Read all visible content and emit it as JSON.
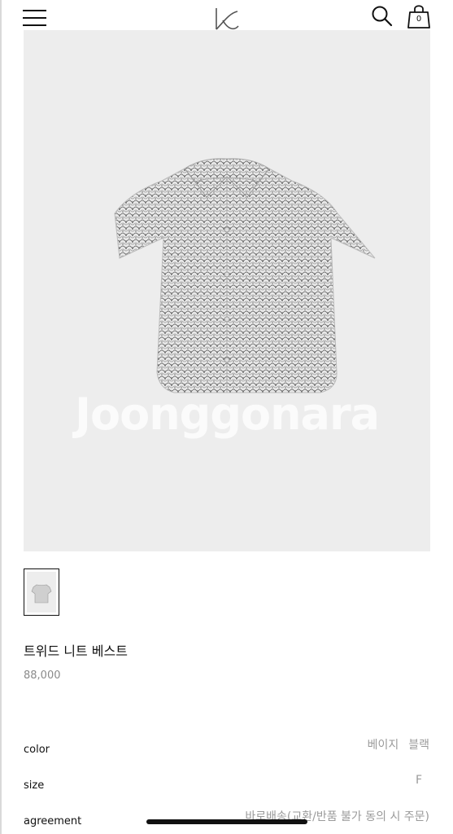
{
  "header": {
    "menu_icon": "hamburger-menu-icon",
    "logo_icon": "brand-logo",
    "search_icon": "search-icon",
    "cart_icon": "shopping-bag-icon",
    "cart_count": "0"
  },
  "product": {
    "image_watermark": "Joonggonara",
    "name": "트위드 니트 베스트",
    "price": "88,000"
  },
  "options": {
    "color": {
      "label": "color",
      "values": [
        "베이지",
        "블랙"
      ]
    },
    "size": {
      "label": "size",
      "values": [
        "F"
      ]
    },
    "agreement": {
      "label": "agreement",
      "values": [
        "바로배송(교환/반품 불가 동의 시 주문)"
      ]
    }
  }
}
